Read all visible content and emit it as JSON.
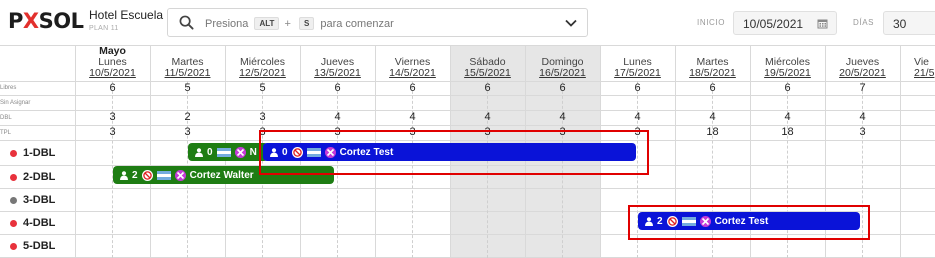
{
  "brand": {
    "logo_left": "P",
    "logo_x": "X",
    "logo_right": "SOL",
    "hotel_name": "Hotel Escuela",
    "plan": "PLAN 11"
  },
  "search": {
    "prefix": "Presiona",
    "key1": "ALT",
    "plus": "+",
    "key2": "S",
    "suffix": "para comenzar"
  },
  "filters": {
    "inicio_label": "INICIO",
    "inicio_value": "10/05/2021",
    "dias_label": "DÍAS",
    "dias_value": "30"
  },
  "calendar": {
    "month": "Mayo",
    "days": [
      {
        "weekday": "Lunes",
        "date": "10/5/2021",
        "weekend": false
      },
      {
        "weekday": "Martes",
        "date": "11/5/2021",
        "weekend": false
      },
      {
        "weekday": "Miércoles",
        "date": "12/5/2021",
        "weekend": false
      },
      {
        "weekday": "Jueves",
        "date": "13/5/2021",
        "weekend": false
      },
      {
        "weekday": "Viernes",
        "date": "14/5/2021",
        "weekend": false
      },
      {
        "weekday": "Sábado",
        "date": "15/5/2021",
        "weekend": true
      },
      {
        "weekday": "Domingo",
        "date": "16/5/2021",
        "weekend": true
      },
      {
        "weekday": "Lunes",
        "date": "17/5/2021",
        "weekend": false
      },
      {
        "weekday": "Martes",
        "date": "18/5/2021",
        "weekend": false
      },
      {
        "weekday": "Miércoles",
        "date": "19/5/2021",
        "weekend": false
      },
      {
        "weekday": "Jueves",
        "date": "20/5/2021",
        "weekend": false
      },
      {
        "weekday": "Vie",
        "date": "21/5",
        "weekend": false
      }
    ],
    "summary_rows": [
      {
        "label": "Libres",
        "values": [
          "6",
          "5",
          "5",
          "6",
          "6",
          "6",
          "6",
          "6",
          "6",
          "6",
          "7",
          ""
        ]
      },
      {
        "label": "Sin Asignar",
        "values": [
          "",
          "",
          "",
          "",
          "",
          "",
          "",
          "",
          "",
          "",
          "",
          ""
        ]
      },
      {
        "label": "DBL",
        "values": [
          "3",
          "2",
          "3",
          "4",
          "4",
          "4",
          "4",
          "4",
          "4",
          "4",
          "4",
          ""
        ]
      },
      {
        "label": "TPL",
        "values": [
          "3",
          "3",
          "3",
          "3",
          "3",
          "3",
          "3",
          "3",
          "18",
          "18",
          "3",
          ""
        ]
      }
    ],
    "rooms": [
      {
        "name": "1-DBL",
        "dot": "#e8323c"
      },
      {
        "name": "2-DBL",
        "dot": "#e8323c"
      },
      {
        "name": "3-DBL",
        "dot": "#777777"
      },
      {
        "name": "4-DBL",
        "dot": "#e8323c"
      },
      {
        "name": "5-DBL",
        "dot": "#e8323c"
      }
    ]
  },
  "reservations": [
    {
      "guests": "0",
      "name": "N",
      "color": "green"
    },
    {
      "guests": "0",
      "name": "Cortez Test",
      "color": "blue"
    },
    {
      "guests": "2",
      "name": "Cortez Walter",
      "color": "green"
    },
    {
      "guests": "2",
      "name": "Cortez Test",
      "color": "blue"
    }
  ],
  "colors": {
    "green": "#1e7d13",
    "blue": "#0a13d8",
    "highlight": "#e00000",
    "weekend": "#e6e6e6"
  }
}
